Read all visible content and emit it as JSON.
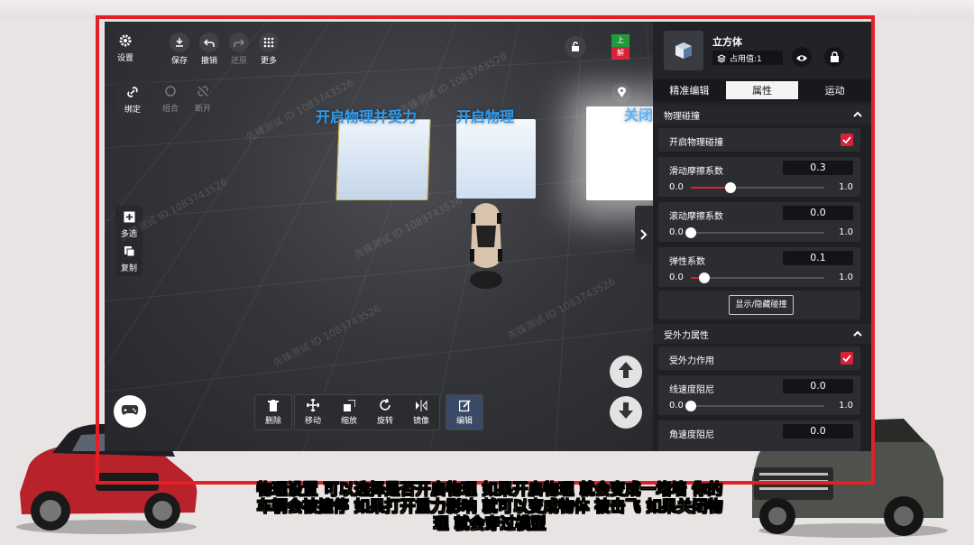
{
  "toolbar": {
    "settings": "设置",
    "save": "保存",
    "undo": "撤销",
    "redo": "还原",
    "more": "更多"
  },
  "left_tools": {
    "bind": "绑定",
    "combine": "组合",
    "disconnect": "断开",
    "multi_select": "多选",
    "copy": "复制"
  },
  "top_right": {
    "badge_top": "上",
    "badge_bottom": "解"
  },
  "scene_labels": {
    "label1": "开启物理并受力",
    "label2": "开启物理",
    "label3": "关闭"
  },
  "bottom_tools": [
    {
      "label": "删除",
      "icon": "trash-icon"
    },
    {
      "label": "移动",
      "icon": "move-icon"
    },
    {
      "label": "缩放",
      "icon": "scale-icon"
    },
    {
      "label": "旋转",
      "icon": "rotate-icon"
    },
    {
      "label": "镜像",
      "icon": "mirror-icon"
    },
    {
      "label": "编辑",
      "icon": "edit-icon"
    }
  ],
  "panel": {
    "object_name": "立方体",
    "occupancy": "占用值:1",
    "tabs": [
      "精准编辑",
      "属性",
      "运动"
    ],
    "active_tab": "属性",
    "physics_collision": {
      "title": "物理碰撞",
      "enable_label": "开启物理碰撞",
      "enable_checked": true,
      "sliding_friction": {
        "label": "滑动摩擦系数",
        "value": "0.3",
        "min": "0.0",
        "max": "1.0",
        "ratio": 0.3
      },
      "rolling_friction": {
        "label": "滚动摩擦系数",
        "value": "0.0",
        "min": "0.0",
        "max": "1.0",
        "ratio": 0.0
      },
      "elasticity": {
        "label": "弹性系数",
        "value": "0.1",
        "min": "0.0",
        "max": "1.0",
        "ratio": 0.1
      },
      "toggle_button": "显示/隐藏碰撞"
    },
    "external_force": {
      "title": "受外力属性",
      "enable_label": "受外力作用",
      "enable_checked": true,
      "linear_damping": {
        "label": "线速度阻尼",
        "value": "0.0",
        "min": "0.0",
        "max": "1.0",
        "ratio": 0.0
      },
      "angular_damping": {
        "label": "角速度阻尼",
        "value": "0.0"
      }
    }
  },
  "caption": {
    "line1": "物理设置 可以选择是否开启物理  如果开启物理 就会变成一堵墙 你的",
    "line2": "车辆会被撞停 如果打开重力影响 就可以变成物体 被击飞 如果关闭物",
    "line3": "理 就会穿过模型"
  },
  "watermark": "先锋测试 ID 1083743526",
  "colors": {
    "accent_red": "#d8203a",
    "label_blue": "#2f9bf0",
    "caption_yellow": "#ffe21b"
  }
}
